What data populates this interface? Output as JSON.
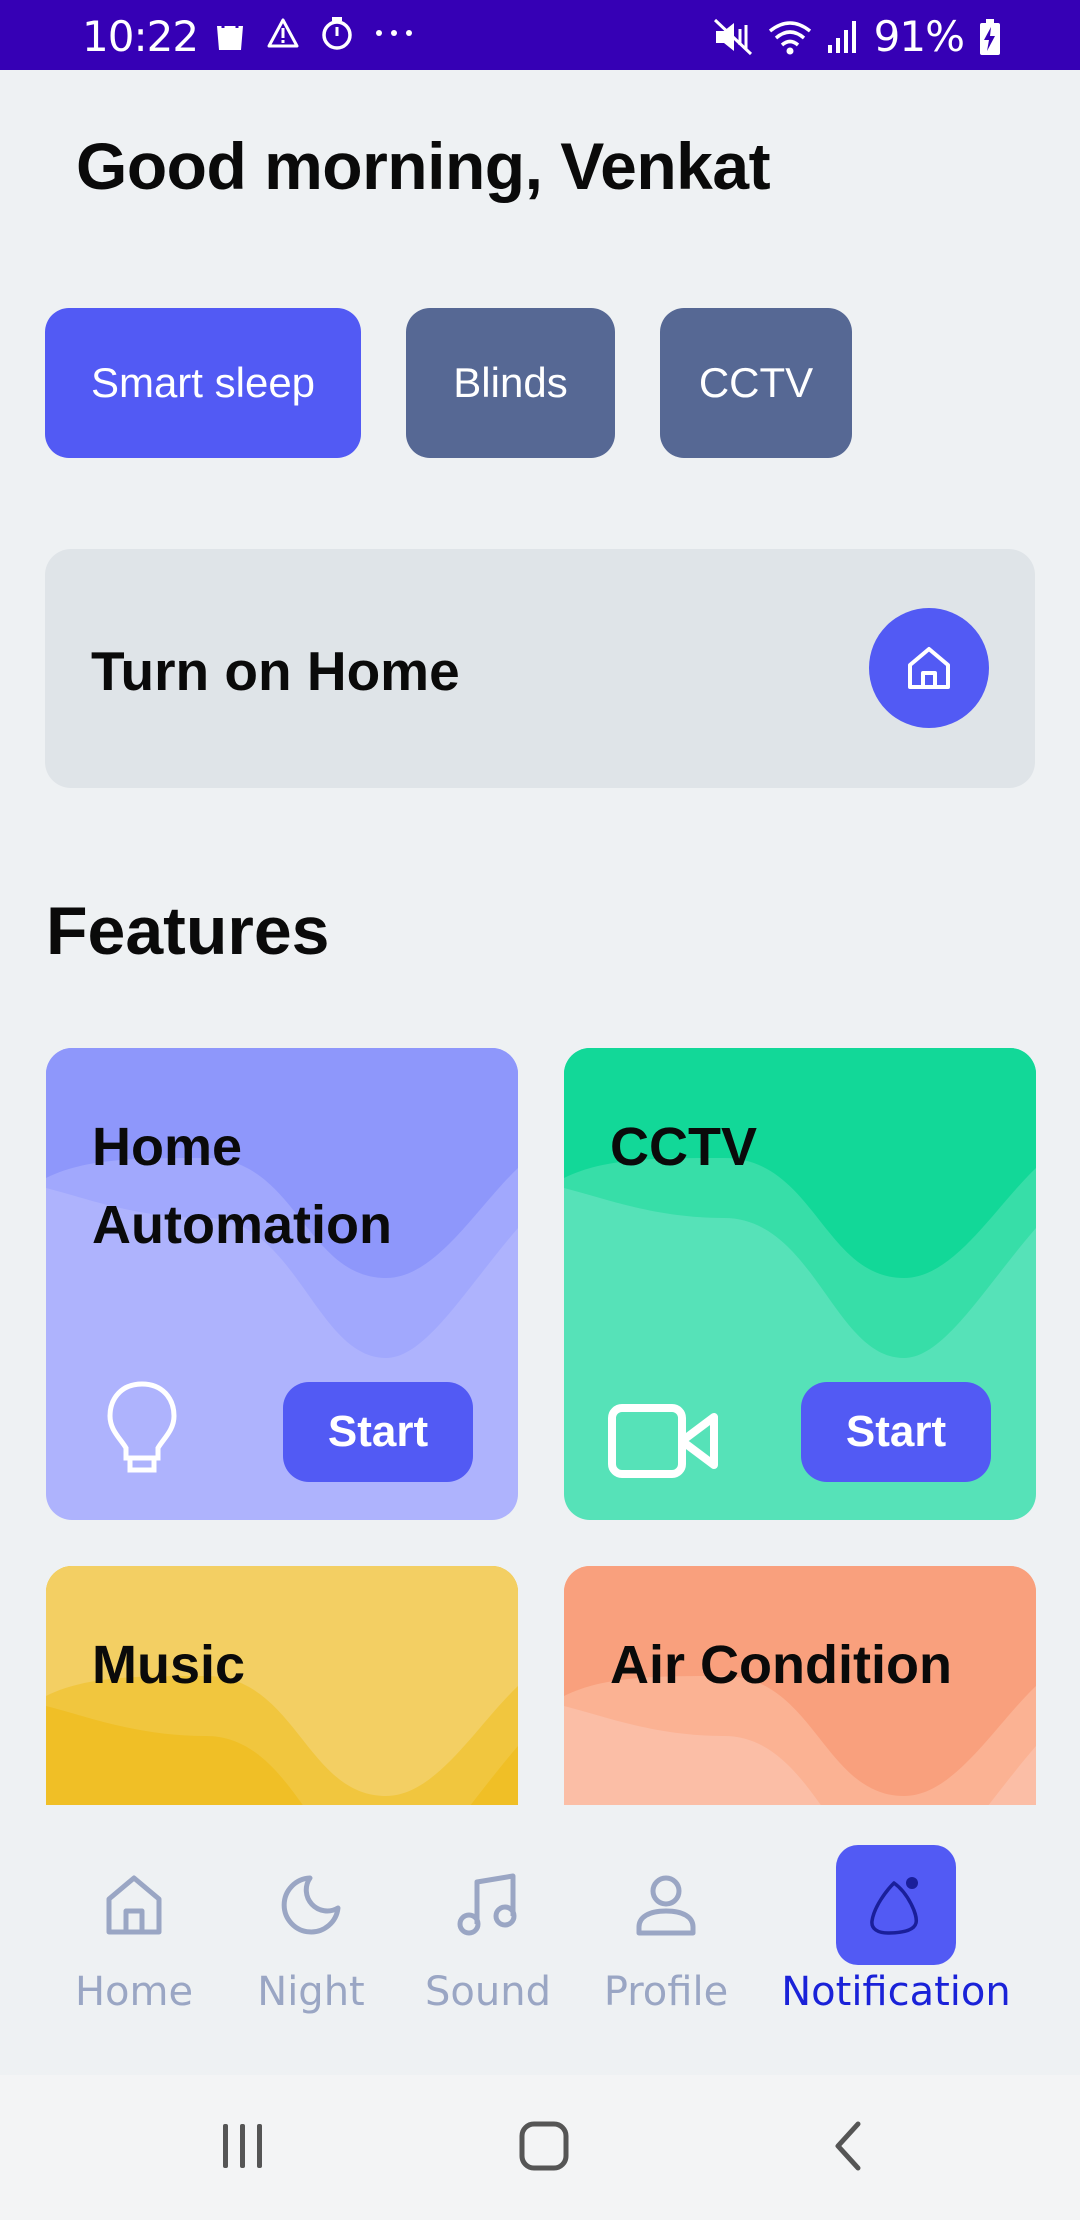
{
  "status_bar": {
    "time": "10:22",
    "battery": "91%",
    "background": "#3600b5"
  },
  "greeting": "Good morning, Venkat",
  "quick_chips": [
    {
      "label": "Smart sleep",
      "active": true
    },
    {
      "label": "Blinds",
      "active": false
    },
    {
      "label": "CCTV",
      "active": false
    }
  ],
  "home_toggle": {
    "label": "Turn on Home",
    "icon": "home-icon"
  },
  "features": {
    "title": "Features",
    "cards": [
      {
        "title": "Home Automation",
        "button": "Start",
        "icon": "lightbulb-icon",
        "color": "#9ea6fb"
      },
      {
        "title": "CCTV",
        "button": "Start",
        "icon": "video-camera-icon",
        "color": "#37dea8"
      },
      {
        "title": "Music",
        "color": "#f3cf63"
      },
      {
        "title": "Air Condition",
        "color": "#f9a585"
      }
    ]
  },
  "bottom_nav": {
    "items": [
      {
        "label": "Home",
        "icon": "home-icon"
      },
      {
        "label": "Night",
        "icon": "moon-icon"
      },
      {
        "label": "Sound",
        "icon": "music-note-icon"
      },
      {
        "label": "Profile",
        "icon": "user-icon"
      },
      {
        "label": "Notification",
        "icon": "notification-icon",
        "active": true
      }
    ]
  },
  "colors": {
    "accent": "#525af4",
    "chip_idle": "#566894",
    "nav_active_text": "#1a22d8",
    "nav_inactive": "#9aa6c4"
  }
}
